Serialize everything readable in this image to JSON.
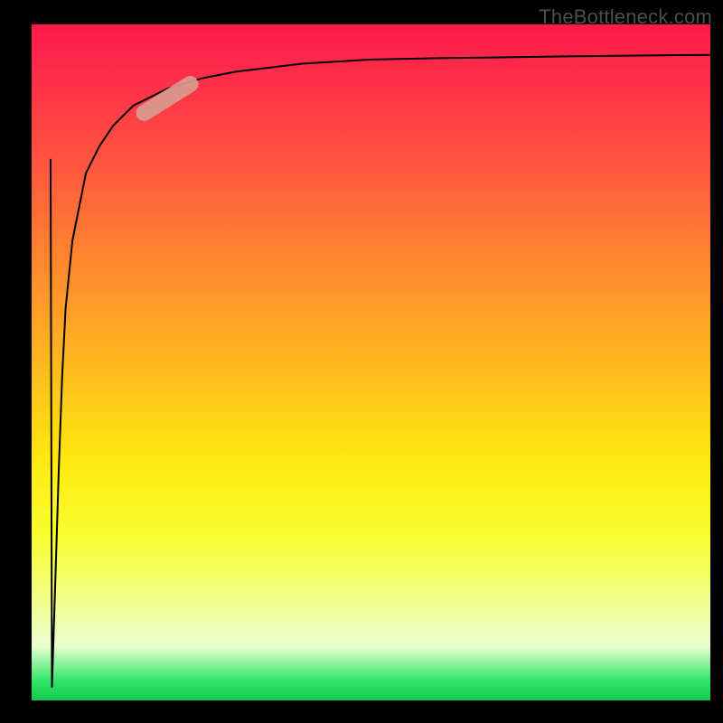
{
  "watermark": "TheBottleneck.com",
  "colors": {
    "background": "#000000",
    "gradient_top": "#ff1a4c",
    "gradient_bottom": "#12c84e",
    "curve": "#000000",
    "marker": "#d89b8f"
  },
  "chart_data": {
    "type": "line",
    "title": "",
    "xlabel": "",
    "ylabel": "",
    "xlim": [
      0,
      100
    ],
    "ylim": [
      0,
      100
    ],
    "x": [
      3,
      3.5,
      4,
      4.5,
      5,
      6,
      8,
      10,
      12,
      15,
      20,
      25,
      30,
      40,
      50,
      60,
      80,
      100
    ],
    "values": [
      2,
      18,
      34,
      48,
      58,
      68,
      78,
      82,
      85,
      88,
      90.5,
      92,
      93,
      94.2,
      94.8,
      95,
      95.3,
      95.5
    ],
    "marker": {
      "x": 20,
      "y": 89,
      "angle_deg": -32
    },
    "note": "Values are percentages of the plot area; x and y axes have no visible tick labels in the source image."
  }
}
